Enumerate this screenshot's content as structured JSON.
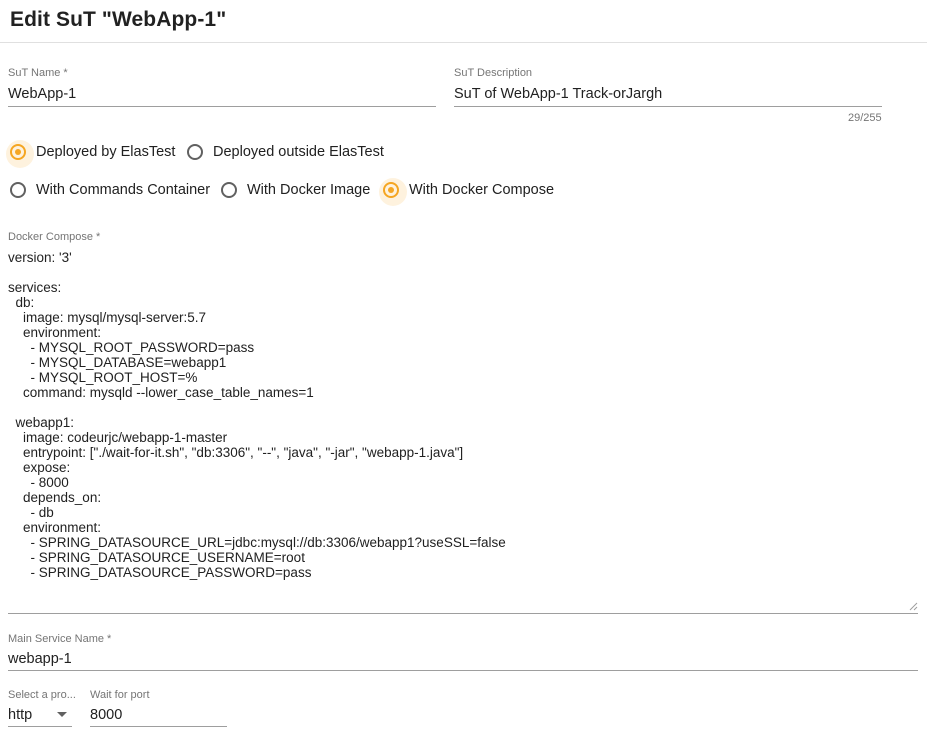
{
  "page": {
    "title": "Edit SuT \"WebApp-1\""
  },
  "sut_name": {
    "label": "SuT Name *",
    "value": "WebApp-1"
  },
  "sut_description": {
    "label": "SuT Description",
    "value": "SuT of WebApp-1 Track-orJargh",
    "counter": "29/255"
  },
  "deployment": {
    "options": [
      {
        "label": "Deployed by ElasTest",
        "checked": true
      },
      {
        "label": "Deployed outside ElasTest",
        "checked": false
      }
    ]
  },
  "instrumentation": {
    "options": [
      {
        "label": "With Commands Container",
        "checked": false
      },
      {
        "label": "With Docker Image",
        "checked": false
      },
      {
        "label": "With Docker Compose",
        "checked": true
      }
    ]
  },
  "docker_compose": {
    "label": "Docker Compose *",
    "value": "version: '3'\n\nservices:\n  db:\n    image: mysql/mysql-server:5.7\n    environment:\n      - MYSQL_ROOT_PASSWORD=pass\n      - MYSQL_DATABASE=webapp1\n      - MYSQL_ROOT_HOST=%\n    command: mysqld --lower_case_table_names=1\n\n  webapp1:\n    image: codeurjc/webapp-1-master\n    entrypoint: [\"./wait-for-it.sh\", \"db:3306\", \"--\", \"java\", \"-jar\", \"webapp-1.java\"]\n    expose:\n      - 8000\n    depends_on:\n      - db\n    environment:\n      - SPRING_DATASOURCE_URL=jdbc:mysql://db:3306/webapp1?useSSL=false\n      - SPRING_DATASOURCE_USERNAME=root\n      - SPRING_DATASOURCE_PASSWORD=pass"
  },
  "main_service": {
    "label": "Main Service Name *",
    "value": "webapp-1"
  },
  "protocol": {
    "label": "Select a pro...",
    "value": "http"
  },
  "wait_port": {
    "label": "Wait for port",
    "value": "8000"
  },
  "colors": {
    "accent": "#f5a623",
    "text": "#212121",
    "label": "#757575",
    "divider": "#9e9e9e"
  }
}
